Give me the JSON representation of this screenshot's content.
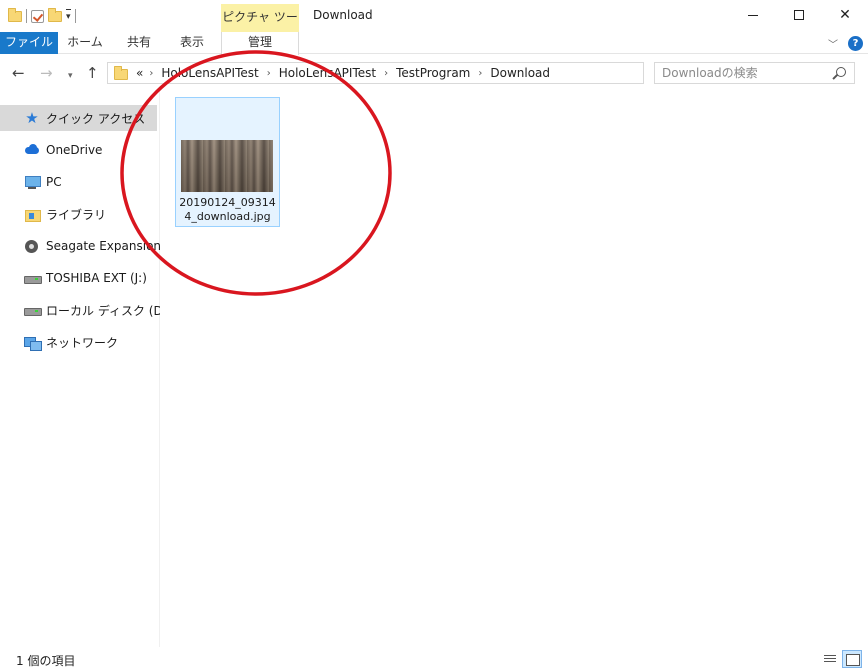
{
  "window": {
    "title": "Download",
    "context_tab": "ピクチャ ツール"
  },
  "ribbon": {
    "tabs": [
      {
        "label": "ファイル"
      },
      {
        "label": "ホーム"
      },
      {
        "label": "共有"
      },
      {
        "label": "表示"
      },
      {
        "label": "管理"
      }
    ]
  },
  "address": {
    "overflow": "«",
    "crumbs": [
      "HoloLensAPITest",
      "HoloLensAPITest",
      "TestProgram",
      "Download"
    ]
  },
  "search": {
    "placeholder": "Downloadの検索"
  },
  "navpane": {
    "items": [
      {
        "label": "クイック アクセス",
        "icon": "star-icon"
      },
      {
        "label": "OneDrive",
        "icon": "cloud-icon"
      },
      {
        "label": "PC",
        "icon": "monitor-icon"
      },
      {
        "label": "ライブラリ",
        "icon": "library-icon"
      },
      {
        "label": "Seagate Expansion Dr",
        "icon": "disk-icon"
      },
      {
        "label": "TOSHIBA EXT (J:)",
        "icon": "drive-icon"
      },
      {
        "label": "ローカル ディスク (D:)",
        "icon": "drive-icon"
      },
      {
        "label": "ネットワーク",
        "icon": "network-icon"
      }
    ]
  },
  "files": [
    {
      "name": "20190124_093144_download.jpg"
    }
  ],
  "status": {
    "count": "1 個の項目"
  },
  "colors": {
    "accent": "#1979ca",
    "context_tab": "#fbf1a6",
    "annotation": "#d9161f",
    "selection": "#cce8ff"
  }
}
